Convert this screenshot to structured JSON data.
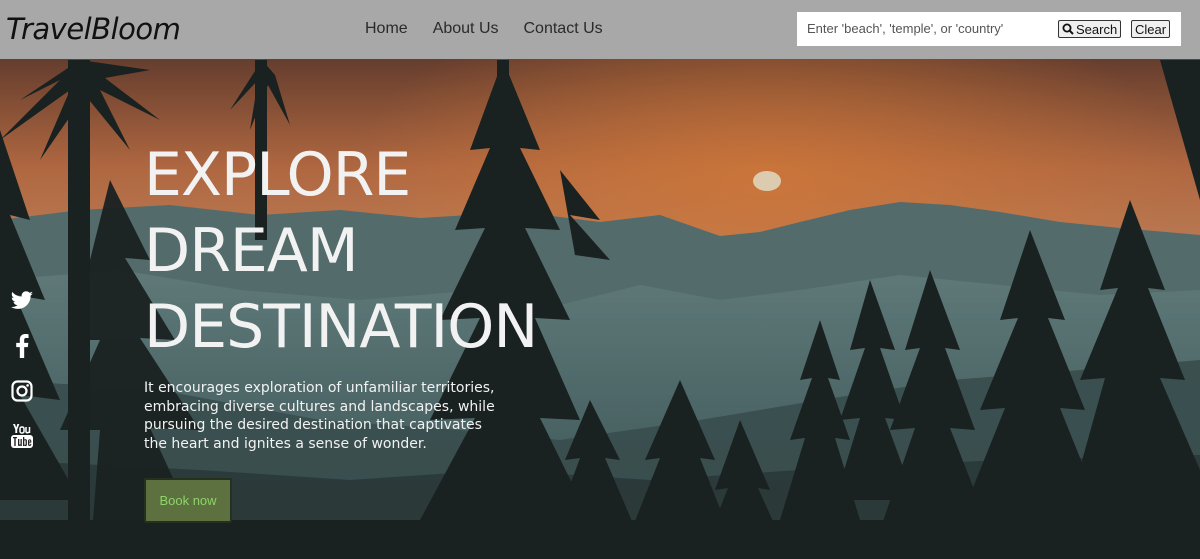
{
  "navbar": {
    "brand": "TravelBloom",
    "links": [
      {
        "label": "Home"
      },
      {
        "label": "About Us"
      },
      {
        "label": "Contact Us"
      }
    ],
    "search": {
      "placeholder": "Enter 'beach', 'temple', or 'country'",
      "value": "",
      "search_label": "Search",
      "clear_label": "Clear",
      "search_icon": "search-icon"
    }
  },
  "hero": {
    "title_lines": [
      "EXPLORE",
      "DREAM",
      "DESTINATION"
    ],
    "description": "It encourages exploration of unfamiliar territories, embracing diverse cultures and landscapes, while pursuing the desired destination that captivates the heart and ignites a sense of wonder.",
    "cta_label": "Book now",
    "background": "sunset-over-mountains-with-pine-trees"
  },
  "social": {
    "icons": [
      "twitter-icon",
      "facebook-icon",
      "instagram-icon",
      "youtube-icon"
    ]
  },
  "colors": {
    "navbar_bg": "#a8a8a8",
    "cta_bg": "#5c7040",
    "cta_text": "#8fd46a",
    "hero_text": "#f2f2f2"
  }
}
